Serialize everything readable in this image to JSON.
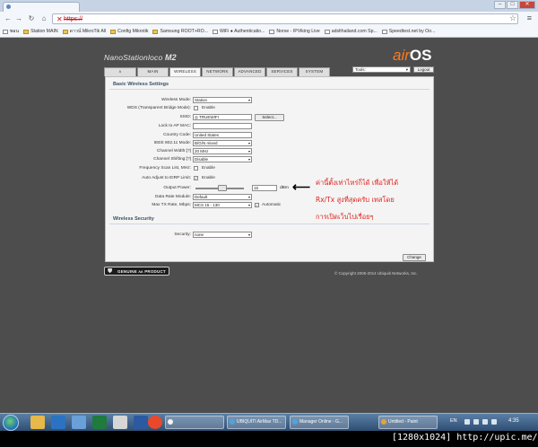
{
  "browser": {
    "tab_title": "",
    "url": "https://",
    "window_controls": [
      "–",
      "□",
      "✕"
    ],
    "nav_icons": [
      "back-arrow-icon",
      "forward-arrow-icon",
      "reload-icon",
      "home-icon"
    ],
    "bookmarks": [
      {
        "label": "พอน",
        "icon": "page-icon"
      },
      {
        "label": "Station MAIN",
        "icon": "folder-icon"
      },
      {
        "label": "ดาวน์ MikroTik All",
        "icon": "folder-icon"
      },
      {
        "label": "Config Mikrotik",
        "icon": "folder-icon"
      },
      {
        "label": "Samsung ROOT+RO...",
        "icon": "folder-icon"
      },
      {
        "label": "WiFi ● Authenticatio...",
        "icon": "page-icon"
      },
      {
        "label": "Norse - IPViking Live",
        "icon": "page-icon"
      },
      {
        "label": "adslthailand.com Sp...",
        "icon": "page-icon"
      },
      {
        "label": "Speedtest.net by Oo...",
        "icon": "page-icon"
      }
    ]
  },
  "device": {
    "brand": "NanoStation",
    "model": "loco",
    "variant": "M2",
    "logo_air": "air",
    "logo_os": "OS"
  },
  "toolbar": {
    "tools_label": "Tools:",
    "logout_label": "Logout"
  },
  "tabs": [
    {
      "label": "ᴧ",
      "width": 36
    },
    {
      "label": "MAIN",
      "width": 35
    },
    {
      "label": "WIRELESS",
      "width": 35,
      "active": true
    },
    {
      "label": "NETWORK",
      "width": 35
    },
    {
      "label": "ADVANCED",
      "width": 35
    },
    {
      "label": "SERVICES",
      "width": 35
    },
    {
      "label": "SYSTEM",
      "width": 35
    }
  ],
  "basic": {
    "title": "Basic Wireless Settings",
    "wireless_mode_label": "Wireless Mode:",
    "wireless_mode_value": "Station",
    "wds_label": "WDS (Transparent Bridge Mode):",
    "wds_enable": "Enable",
    "ssid_label": "SSID:",
    "ssid_value": "TRUEWIFI",
    "select_button": "Select...",
    "lock_ap_label": "Lock to AP MAC:",
    "lock_ap_value": "",
    "country_label": "Country Code:",
    "country_value": "United States",
    "ieee_label": "IEEE 802.11 Mode:",
    "ieee_value": "B/G/N mixed",
    "channel_width_label": "Channel Width:[?]",
    "channel_width_value": "20 MHz",
    "channel_shift_label": "Channel Shifting:[?]",
    "channel_shift_value": "Disable",
    "freq_scan_label": "Frequency Scan List, MHz:",
    "freq_scan_enable": "Enable",
    "auto_eirp_label": "Auto Adjust to EIRP Limit:",
    "auto_eirp_enable": "Enable",
    "output_power_label": "Output Power:",
    "output_power_value": "15",
    "output_power_unit": "dBm",
    "output_power_level": 0.55,
    "data_rate_label": "Data Rate Module:",
    "data_rate_value": "Default",
    "max_tx_label": "Max TX Rate, Mbps:",
    "max_tx_value": "MCS 15 - 130",
    "automatic_label": "Automatic"
  },
  "security": {
    "title": "Wireless Security",
    "security_label": "Security:",
    "security_value": "none"
  },
  "change_button": "Change",
  "genuine_label": "GENUINE ᴧᴧ PRODUCT",
  "copyright": "© Copyright 2006-2014 Ubiquiti Networks, Inc.",
  "annotation": {
    "line1": "ค่านี้ตั้งเท่าไหร่ก็ได้    เพื่อให้ได้",
    "line2": "Rx/Tx สูงที่สุดครับ   เทสโดย",
    "line3": "การเปิดเว็บไปเรื่อยๆ"
  },
  "taskbar": {
    "items": [
      {
        "label": "",
        "color": "#f4f4f4"
      },
      {
        "label": "UBIQUITI AirMax TD...",
        "color": "#4fa3e0"
      },
      {
        "label": "Manager Online - G...",
        "color": "#4fa3e0"
      },
      {
        "label": "Untitled - Paint",
        "color": "#e5a33d"
      }
    ],
    "lang": "EN",
    "time": "4:35"
  },
  "watermark": "[1280x1024] http://upic.me/"
}
